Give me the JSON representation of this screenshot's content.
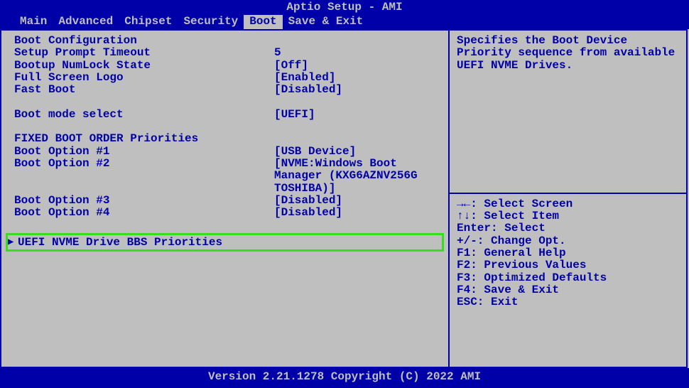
{
  "title": "Aptio Setup - AMI",
  "menu": {
    "items": [
      "Main",
      "Advanced",
      "Chipset",
      "Security",
      "Boot",
      "Save & Exit"
    ],
    "active_index": 4
  },
  "left": {
    "section1": "Boot Configuration",
    "rows1": [
      {
        "label": "Setup Prompt Timeout",
        "value": "5"
      },
      {
        "label": "Bootup NumLock State",
        "value": "[Off]"
      },
      {
        "label": "Full Screen Logo",
        "value": "[Enabled]"
      },
      {
        "label": "Fast Boot",
        "value": "[Disabled]"
      }
    ],
    "rows2": [
      {
        "label": "Boot mode select",
        "value": "[UEFI]"
      }
    ],
    "section2": "FIXED BOOT ORDER Priorities",
    "rows3": [
      {
        "label": "Boot Option #1",
        "value": "[USB Device]"
      },
      {
        "label": "Boot Option #2",
        "value": "[NVME:Windows Boot"
      },
      {
        "label": "",
        "value": "Manager (KXG6AZNV256G"
      },
      {
        "label": "",
        "value": "TOSHIBA)]"
      },
      {
        "label": "Boot Option #3",
        "value": "[Disabled]"
      },
      {
        "label": "Boot Option #4",
        "value": "[Disabled]"
      }
    ],
    "submenu": "UEFI NVME Drive BBS Priorities"
  },
  "right": {
    "help": "Specifies the Boot Device Priority sequence from available UEFI NVME Drives.",
    "keys": [
      "→←: Select Screen",
      "↑↓: Select Item",
      "Enter: Select",
      "+/-: Change Opt.",
      "F1: General Help",
      "F2: Previous Values",
      "F3: Optimized Defaults",
      "F4: Save & Exit",
      "ESC: Exit"
    ]
  },
  "footer": "Version 2.21.1278 Copyright (C) 2022 AMI"
}
